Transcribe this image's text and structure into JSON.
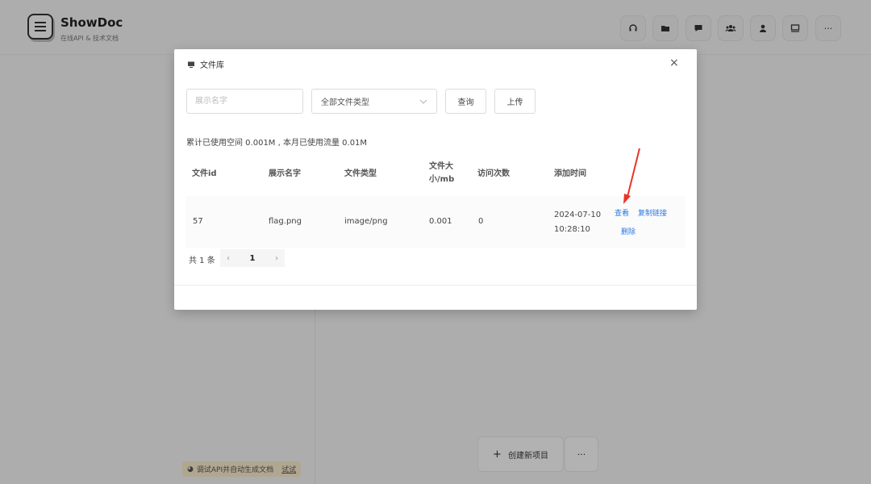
{
  "app": {
    "brand": "ShowDoc",
    "tagline": "在线API & 技术文档",
    "header_icons": [
      "headset-icon",
      "folder-icon",
      "message-icon",
      "team-icon",
      "user-icon",
      "screen-icon",
      "more-icon"
    ]
  },
  "footer": {
    "tip_text": "调试API并自动生成文档",
    "tip_link": "试试",
    "create_label": "创建新项目",
    "more_label": "···"
  },
  "modal": {
    "title": "文件库",
    "close": "×",
    "search_placeholder": "展示名字",
    "type_select": "全部文件类型",
    "search_button": "查询",
    "upload_button": "上传",
    "usage": "累计已使用空间 0.001M , 本月已使用流量 0.01M",
    "columns": [
      "文件id",
      "展示名字",
      "文件类型",
      "文件大小/mb",
      "访问次数",
      "添加时间"
    ],
    "rows": [
      {
        "id": "57",
        "name": "flag.png",
        "type": "image/png",
        "size": "0.001",
        "visits": "0",
        "date": "2024-07-10",
        "time": "10:28:10",
        "actions": [
          "查看",
          "复制链接",
          "删除"
        ]
      }
    ],
    "pager": {
      "total": "共 1 条",
      "prev": "‹",
      "current": "1",
      "next": "›"
    }
  },
  "colors": {
    "link": "#2a7ae4",
    "annotation_arrow": "#e8342a"
  }
}
